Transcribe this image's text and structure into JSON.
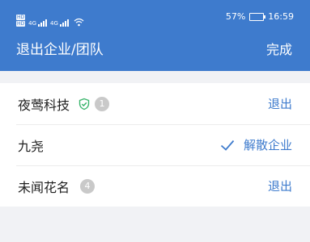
{
  "status_bar": {
    "hd_badges": [
      "HD",
      "HD"
    ],
    "signal_labels": [
      "4G",
      "4G"
    ],
    "battery": "57%",
    "battery_level": 0.57,
    "time": "16:59"
  },
  "header": {
    "title": "退出企业/团队",
    "done_label": "完成"
  },
  "orgs": [
    {
      "name": "夜莺科技",
      "verified": true,
      "badge_count": "1",
      "action": "退出",
      "selected": false
    },
    {
      "name": "九尧",
      "verified": false,
      "badge_count": "",
      "action": "解散企业",
      "selected": true
    },
    {
      "name": "未闻花名",
      "verified": false,
      "badge_count": "4",
      "action": "退出",
      "selected": false
    }
  ],
  "colors": {
    "header": "#3e7bcd",
    "accent": "#3e7bcd",
    "verified": "#3bb56d",
    "badge": "#c9c9c9"
  },
  "icons": {
    "verified": "shield-check-icon",
    "selected": "checkmark-icon",
    "wifi": "wifi-icon"
  }
}
